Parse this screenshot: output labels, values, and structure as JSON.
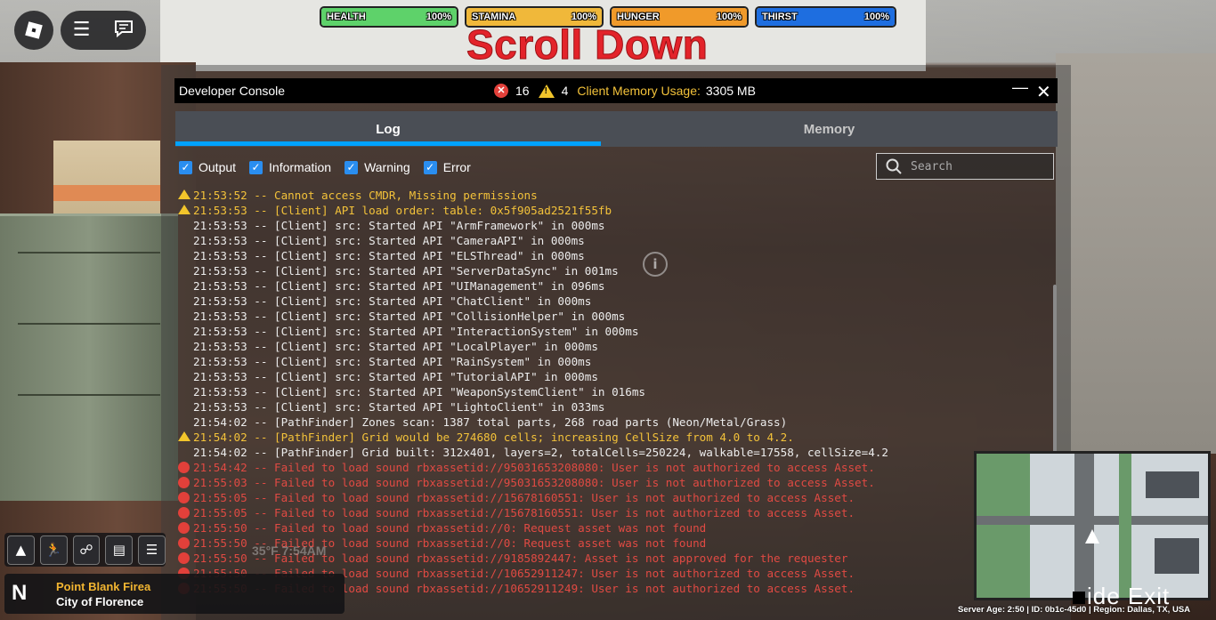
{
  "stats": [
    {
      "label": "HEALTH",
      "value": "100%",
      "color": "#5ed26a",
      "level": 1.0
    },
    {
      "label": "STAMINA",
      "value": "100%",
      "color": "#f0b83a",
      "level": 1.0
    },
    {
      "label": "HUNGER",
      "value": "100%",
      "color": "#f09a2a",
      "level": 1.0
    },
    {
      "label": "THIRST",
      "value": "100%",
      "color": "#1e6ee0",
      "level": 1.0
    }
  ],
  "banner": "Scroll Down",
  "console": {
    "title": "Developer Console",
    "error_count": "16",
    "warning_count": "4",
    "memory_label": "Client Memory Usage:",
    "memory_value": "3305 MB",
    "tabs": {
      "log": "Log",
      "memory": "Memory"
    },
    "filters": {
      "output": "Output",
      "information": "Information",
      "warning": "Warning",
      "error": "Error"
    },
    "search_placeholder": "Search",
    "lines": [
      {
        "type": "warning",
        "text": "21:53:52 -- Cannot access CMDR, Missing permissions"
      },
      {
        "type": "warning",
        "text": "21:53:53 -- [Client] API load order: table: 0x5f905ad2521f55fb"
      },
      {
        "type": "output",
        "text": "21:53:53 -- [Client] src: Started API \"ArmFramework\" in 000ms"
      },
      {
        "type": "output",
        "text": "21:53:53 -- [Client] src: Started API \"CameraAPI\" in 000ms"
      },
      {
        "type": "output",
        "text": "21:53:53 -- [Client] src: Started API \"ELSThread\" in 000ms"
      },
      {
        "type": "output",
        "text": "21:53:53 -- [Client] src: Started API \"ServerDataSync\" in 001ms"
      },
      {
        "type": "output",
        "text": "21:53:53 -- [Client] src: Started API \"UIManagement\" in 096ms"
      },
      {
        "type": "output",
        "text": "21:53:53 -- [Client] src: Started API \"ChatClient\" in 000ms"
      },
      {
        "type": "output",
        "text": "21:53:53 -- [Client] src: Started API \"CollisionHelper\" in 000ms"
      },
      {
        "type": "output",
        "text": "21:53:53 -- [Client] src: Started API \"InteractionSystem\" in 000ms"
      },
      {
        "type": "output",
        "text": "21:53:53 -- [Client] src: Started API \"LocalPlayer\" in 000ms"
      },
      {
        "type": "output",
        "text": "21:53:53 -- [Client] src: Started API \"RainSystem\" in 000ms"
      },
      {
        "type": "output",
        "text": "21:53:53 -- [Client] src: Started API \"TutorialAPI\" in 000ms"
      },
      {
        "type": "output",
        "text": "21:53:53 -- [Client] src: Started API \"WeaponSystemClient\" in 016ms"
      },
      {
        "type": "output",
        "text": "21:53:53 -- [Client] src: Started API \"LightoClient\" in 033ms"
      },
      {
        "type": "output",
        "text": "21:54:02 -- [PathFinder] Zones scan: 1387 total parts, 268 road parts (Neon/Metal/Grass)"
      },
      {
        "type": "warning",
        "text": "21:54:02 -- [PathFinder] Grid would be 274680 cells; increasing CellSize from 4.0 to 4.2."
      },
      {
        "type": "output",
        "text": "21:54:02 -- [PathFinder] Grid built: 312x401, layers=2, totalCells=250224, walkable=17558, cellSize=4.2"
      },
      {
        "type": "error",
        "text": "21:54:42 -- Failed to load sound rbxassetid://95031653208080: User is not authorized to access Asset."
      },
      {
        "type": "error",
        "text": "21:55:03 -- Failed to load sound rbxassetid://95031653208080: User is not authorized to access Asset."
      },
      {
        "type": "error",
        "text": "21:55:05 -- Failed to load sound rbxassetid://15678160551: User is not authorized to access Asset."
      },
      {
        "type": "error",
        "text": "21:55:05 -- Failed to load sound rbxassetid://15678160551: User is not authorized to access Asset."
      },
      {
        "type": "error",
        "text": "21:55:50 -- Failed to load sound rbxassetid://0: Request asset was not found"
      },
      {
        "type": "error",
        "text": "21:55:50 -- Failed to load sound rbxassetid://0: Request asset was not found"
      },
      {
        "type": "error",
        "text": "21:55:50 -- Failed to load sound rbxassetid://9185892447: Asset is not approved for the requester"
      },
      {
        "type": "error",
        "text": "21:55:50 -- Failed to load sound rbxassetid://10652911247: User is not authorized to access Asset."
      },
      {
        "type": "error",
        "text": "21:55:50 -- Failed to load sound rbxassetid://10652911249: User is not authorized to access Asset."
      }
    ]
  },
  "hud": {
    "compass": "N",
    "location_name": "Point Blank Firea",
    "city": "City of Florence",
    "time_ghost": "35°F 7:54AM",
    "hide_exit": "ide Exit",
    "server_info": "Server Age: 2:50 | ID: 0b1c-45d0 | Region: Dallas, TX, USA"
  },
  "colors": {
    "accent": "#00a2ff",
    "error": "#e04a43",
    "warning": "#f3c23a",
    "banner": "#e3232a"
  }
}
